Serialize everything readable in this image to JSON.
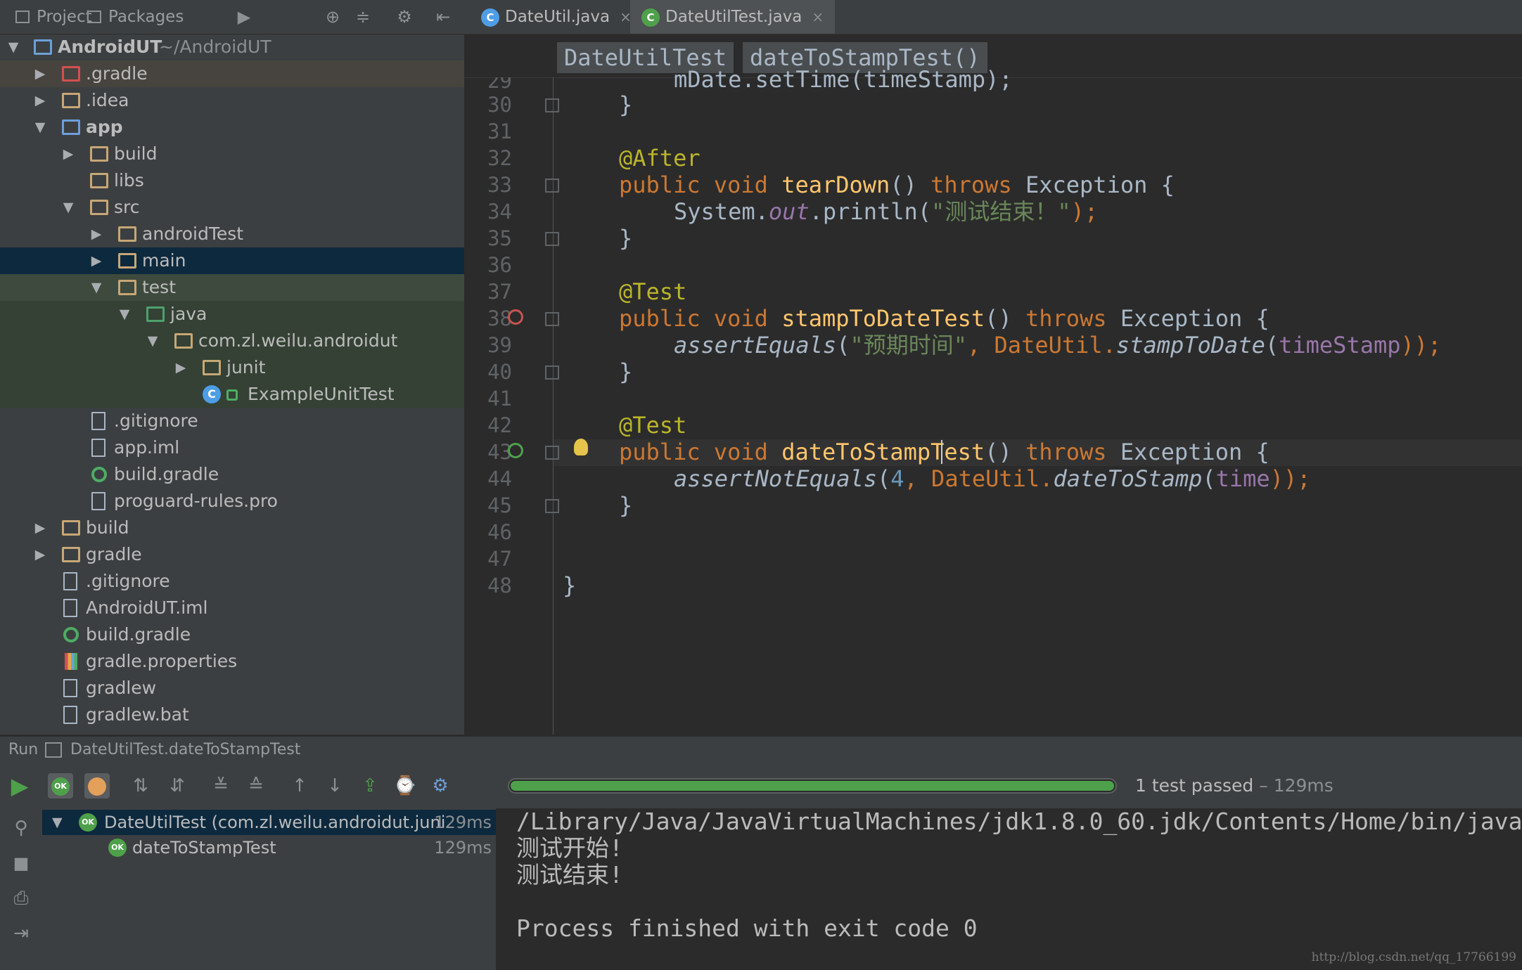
{
  "project_panel": {
    "tabs": [
      {
        "label": "Project"
      },
      {
        "label": "Packages"
      }
    ],
    "tree": [
      {
        "label": "AndroidUT",
        "path": "~/AndroidUT",
        "state": "expanded"
      },
      {
        "label": ".gradle",
        "state": "collapsed"
      },
      {
        "label": ".idea",
        "state": "collapsed"
      },
      {
        "label": "app",
        "state": "expanded"
      },
      {
        "label": "build",
        "state": "collapsed"
      },
      {
        "label": "libs"
      },
      {
        "label": "src",
        "state": "expanded"
      },
      {
        "label": "androidTest",
        "state": "collapsed"
      },
      {
        "label": "main",
        "state": "collapsed",
        "selected": true
      },
      {
        "label": "test",
        "state": "expanded"
      },
      {
        "label": "java",
        "state": "expanded"
      },
      {
        "label": "com.zl.weilu.androidut",
        "state": "expanded"
      },
      {
        "label": "junit",
        "state": "collapsed"
      },
      {
        "label": "ExampleUnitTest"
      },
      {
        "label": ".gitignore"
      },
      {
        "label": "app.iml"
      },
      {
        "label": "build.gradle"
      },
      {
        "label": "proguard-rules.pro"
      },
      {
        "label": "build",
        "state": "collapsed"
      },
      {
        "label": "gradle",
        "state": "collapsed"
      },
      {
        "label": ".gitignore"
      },
      {
        "label": "AndroidUT.iml"
      },
      {
        "label": "build.gradle"
      },
      {
        "label": "gradle.properties"
      },
      {
        "label": "gradlew"
      },
      {
        "label": "gradlew.bat"
      }
    ]
  },
  "editor": {
    "tabs": [
      {
        "label": "DateUtil.java",
        "close": "×"
      },
      {
        "label": "DateUtilTest.java",
        "close": "×",
        "active": true
      }
    ],
    "breadcrumbs": [
      "DateUtilTest",
      "dateToStampTest()"
    ],
    "line_numbers": [
      "29",
      "30",
      "31",
      "32",
      "33",
      "34",
      "35",
      "36",
      "37",
      "38",
      "39",
      "40",
      "41",
      "42",
      "43",
      "44",
      "45",
      "46",
      "47",
      "48"
    ],
    "code": {
      "l29": "mDate.setTime(timeStamp);",
      "l30": "}",
      "l32": "@After",
      "l33": [
        "public void ",
        "tearDown",
        "() ",
        "throws",
        " Exception {"
      ],
      "l34": [
        "System.",
        "out",
        ".println(",
        "\"测试结束！\"",
        ");"
      ],
      "l35": "}",
      "l37": "@Test",
      "l38": [
        "public void ",
        "stampToDateTest",
        "() ",
        "throws",
        " Exception {"
      ],
      "l39": [
        "assertEquals",
        "(",
        "\"预期时间\"",
        ", DateUtil.",
        "stampToDate",
        "(",
        "timeStamp",
        "));"
      ],
      "l40": "}",
      "l42": "@Test",
      "l43": [
        "public void ",
        "dateToStampTest",
        "() ",
        "throws",
        " Exception {"
      ],
      "l44": [
        "assertNotEquals",
        "(",
        "4",
        ", DateUtil.",
        "dateToStamp",
        "(",
        "time",
        "));"
      ],
      "l45": "}",
      "l48": "}"
    }
  },
  "run_panel": {
    "title": "Run",
    "config": "DateUtilTest.dateToStampTest",
    "status": "1 test passed",
    "status_time": "129ms",
    "status_sep": " – ",
    "progress": 1.0,
    "tree": [
      {
        "label": "DateUtilTest (com.zl.weilu.androidut.juni",
        "time": "129ms",
        "badge": "OK"
      },
      {
        "label": "dateToStampTest",
        "time": "129ms",
        "badge": "OK"
      }
    ],
    "console": [
      "/Library/Java/JavaVirtualMachines/jdk1.8.0_60.jdk/Contents/Home/bin/java",
      "测试开始!",
      "测试结束!",
      "",
      "Process finished with exit code 0"
    ]
  },
  "watermark": "http://blog.csdn.net/qq_17766199",
  "colors": {
    "keyword": "#cc7832",
    "annotation": "#bbb529",
    "method": "#ffc66d",
    "string": "#6a8759",
    "field": "#9876aa",
    "number": "#6897bb",
    "pass": "#4ea14a",
    "selection": "#0d293e"
  }
}
